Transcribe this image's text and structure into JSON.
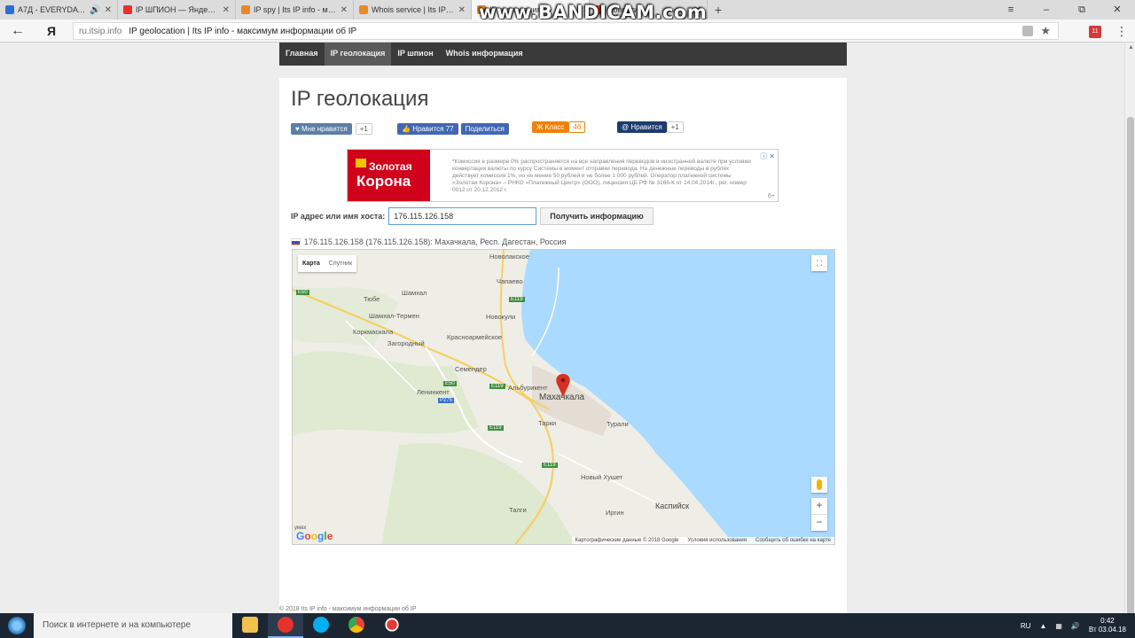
{
  "browser": {
    "tabs": [
      {
        "label": "A7Д - EVERYDAY ▯▯",
        "icon_color": "#2a6fd6",
        "extra": "🔊"
      },
      {
        "label": "IP ШПИОН — Яндекс: наш",
        "icon_color": "#e5322d"
      },
      {
        "label": "IP spy | Its IP info - максиму",
        "icon_color": "#e88a2a"
      },
      {
        "label": "Whois service | Its IP info",
        "icon_color": "#e88a2a"
      },
      {
        "label": "IP геолокация",
        "icon_color": "#e88a2a"
      },
      {
        "label": "Новости",
        "icon_color": "#e5322d"
      }
    ],
    "new_tab": "+",
    "window_controls": [
      "≡",
      "–",
      "⧉",
      "✕"
    ],
    "address": {
      "domain": "ru.itsip.info",
      "title": "IP geolocation | Its IP info - максимум информации об IP"
    },
    "back": "←",
    "yandex": "Я",
    "mail_count": "11",
    "watermark": "www.BANDICAM.com"
  },
  "site": {
    "nav": [
      "Главная",
      "IP геолокация",
      "IP шпион",
      "Whois информация"
    ],
    "page_title": "IP геолокация",
    "social": {
      "vk_like": "Мне нравится",
      "vk_count": "+1",
      "fb_like": "Нравится 77",
      "fb_share": "Поделиться",
      "ok_class": "Класс",
      "ok_count": "46",
      "mail_like": "Нравится",
      "mail_count": "+1"
    },
    "ad": {
      "brand_line1": "Золотая",
      "brand_line2": "Корона",
      "text": "*Комиссия в размере 0% распространяется на все направления переводов в иностранной валюте при условии конвертации валюты по курсу Системы в момент отправки перевода. На денежные переводы в рублях действует комиссия 1%, но не менее 50 рублей и не более 1 000 рублей. Оператор платежной системы «Золотая Корона» – РНКО «Платежный Центр» (ООО), лицензия ЦБ РФ № 3166-К от 14.04.2014г., рег. номер 0012 от 20.12.2012 г.",
      "age": "6+",
      "choices": "ⓘ ✕"
    },
    "form": {
      "label": "IP адрес или имя хоста:",
      "value": "176.115.126.158",
      "button": "Получить информацию"
    },
    "result": "176.115.126.158 (176.115.126.158): Махачкала, Респ. Дагестан, Россия",
    "map": {
      "toggle_map": "Карта",
      "toggle_sat": "Спутник",
      "fullscreen": "⛶",
      "zoom_in": "+",
      "zoom_out": "−",
      "places": {
        "novolakskoe": "Новолакское",
        "chapaevo": "Чапаево",
        "shamkhal": "Шамхал",
        "tyube": "Тюбе",
        "shamkhal_termen": "Шамхал-Термен",
        "novokuli": "Новокули",
        "korkmaskala": "Коркмаскала",
        "krasnoarmeyskoe": "Красноармейское",
        "zagorodny": "Загородный",
        "semender": "Семендер",
        "leninkent": "Ленинкент",
        "alburikent": "Альбурикент",
        "makhachkala": "Махачкала",
        "tarki": "Тарки",
        "turali": "Турали",
        "novy_khushet": "Новый Хушет",
        "talgi": "Талги",
        "irgin": "Иргин",
        "kaspiysk": "Каспийск",
        "umax": "умах"
      },
      "roads": [
        "E50",
        "E119",
        "E119",
        "E50",
        "E119",
        "P275",
        "E119",
        "E119"
      ],
      "google": [
        "G",
        "o",
        "o",
        "g",
        "l",
        "e"
      ],
      "attribution": [
        "Картографические данные © 2018 Google",
        "Условия использования",
        "Сообщить об ошибке на карте"
      ]
    },
    "footer": "© 2018 Its IP info - максимум информации об IP"
  },
  "taskbar": {
    "search_placeholder": "Поиск в интернете и на компьютере",
    "apps": [
      {
        "name": "file-explorer",
        "color": "#f2c14e"
      },
      {
        "name": "yandex-browser",
        "color": "#e5322d",
        "running": true
      },
      {
        "name": "skype",
        "color": "#00aff0"
      },
      {
        "name": "chrome",
        "color": "#4caf50"
      },
      {
        "name": "bandicam",
        "color": "#d32f2f"
      }
    ],
    "lang": "RU",
    "time": "0:42",
    "date": "Вт 03.04.18"
  },
  "colors": {
    "nav_bg": "#3a3a3a",
    "vk": "#5b7fa6",
    "fb": "#4267b2",
    "ok": "#ee8208",
    "mailru": "#168de2",
    "sea": "#aadaff",
    "marker": "#d93025"
  }
}
